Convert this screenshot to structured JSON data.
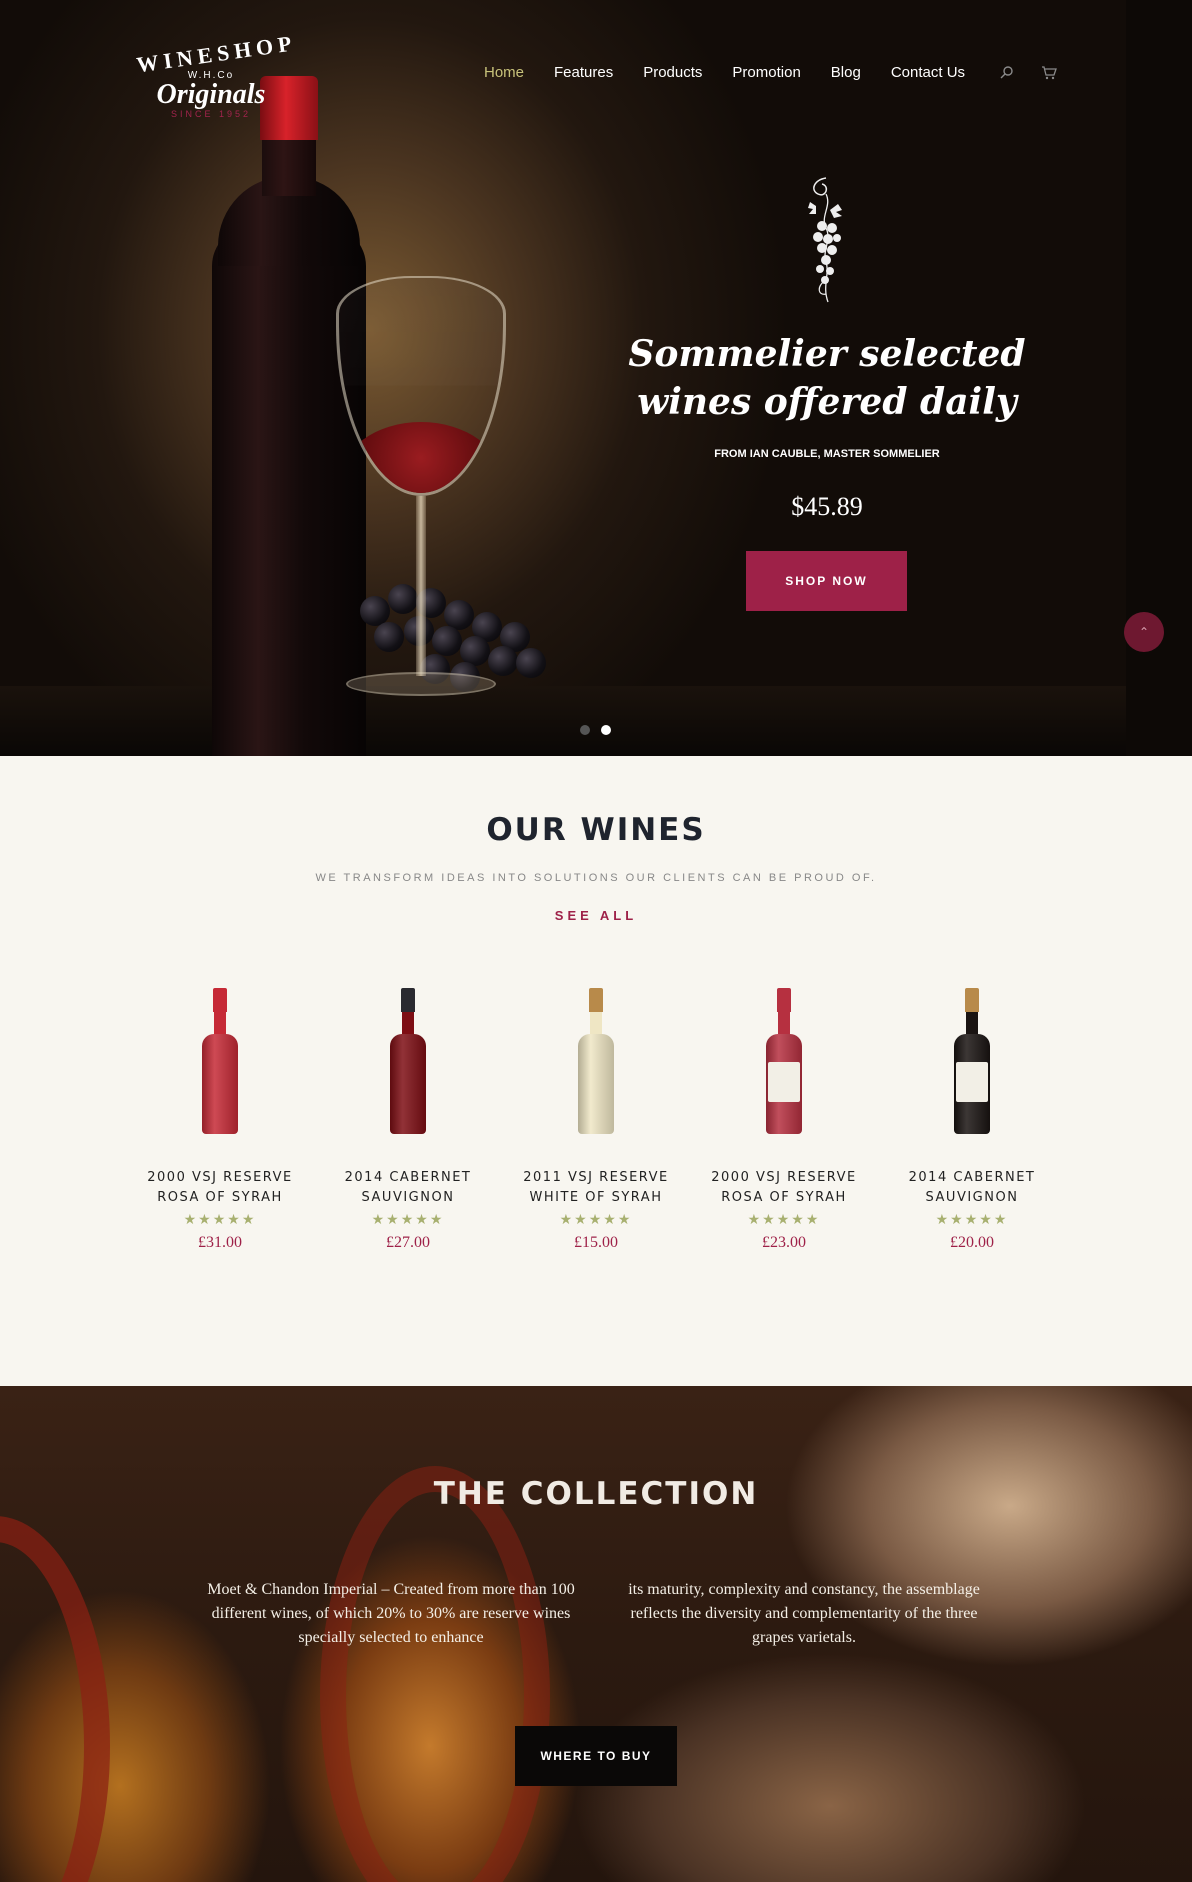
{
  "logo": {
    "line1": "WINESHOP",
    "line2": "W.H.Co",
    "line3": "Originals",
    "line4": "SINCE 1952"
  },
  "nav": {
    "items": [
      {
        "label": "Home",
        "active": true
      },
      {
        "label": "Features"
      },
      {
        "label": "Products"
      },
      {
        "label": "Promotion"
      },
      {
        "label": "Blog"
      },
      {
        "label": "Contact Us"
      }
    ],
    "icons": [
      "search-icon",
      "cart-icon"
    ]
  },
  "hero": {
    "title": "Sommelier selected wines offered daily",
    "subtitle": "FROM IAN CAUBLE, MASTER SOMMELIER",
    "price": "$45.89",
    "button": "SHOP NOW",
    "slides": 2,
    "active_slide": 2,
    "scroll_top_icon": "chevron-up-icon"
  },
  "wines": {
    "title": "OUR WINES",
    "subtitle": "WE TRANSFORM IDEAS INTO SOLUTIONS OUR CLIENTS CAN BE PROUD OF.",
    "see_all": "SEE ALL",
    "stars": "★★★★★",
    "products": [
      {
        "name_line1": "2000 VSJ RESERVE",
        "name_line2": "ROSA OF SYRAH",
        "price": "£31.00",
        "rating": 5,
        "bottle": "#c62a36"
      },
      {
        "name_line1": "2014 CABERNET",
        "name_line2": "SAUVIGNON",
        "price": "£27.00",
        "rating": 5,
        "bottle": "#7e0e14"
      },
      {
        "name_line1": "2011 VSJ RESERVE",
        "name_line2": "WHITE OF SYRAH",
        "price": "£15.00",
        "rating": 5,
        "bottle": "#efe6c4"
      },
      {
        "name_line1": "2000 VSJ RESERVE",
        "name_line2": "ROSA OF SYRAH",
        "price": "£23.00",
        "rating": 5,
        "bottle": "#b63040"
      },
      {
        "name_line1": "2014 CABERNET",
        "name_line2": "SAUVIGNON",
        "price": "£20.00",
        "rating": 5,
        "bottle": "#1a1412"
      }
    ]
  },
  "collection": {
    "title": "THE COLLECTION",
    "text_left": "Moet & Chandon Imperial – Created from more than 100 different wines, of which 20% to 30% are reserve wines specially selected to enhance",
    "text_right": "its maturity, complexity and constancy, the assemblage reflects the diversity and complementarity of the three grapes varietals.",
    "button": "WHERE TO BUY"
  },
  "colors": {
    "accent": "#9e2148",
    "star": "#a8b070",
    "nav_active": "#c8c27a"
  }
}
